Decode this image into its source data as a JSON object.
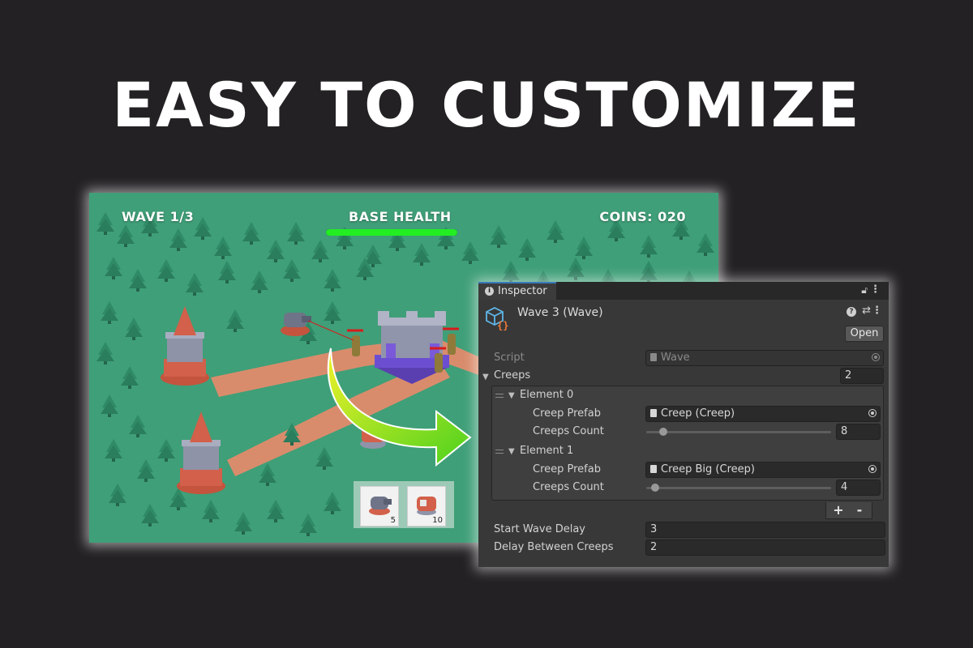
{
  "headline": "EASY TO CUSTOMIZE",
  "game": {
    "wave_label": "WAVE 1/3",
    "base_health_label": "BASE HEALTH",
    "base_health_fraction": 1.0,
    "coins_label": "COINS: 020",
    "shop": [
      {
        "icon": "cannon-tower-icon",
        "price": "5"
      },
      {
        "icon": "flame-tower-icon",
        "price": "10"
      }
    ],
    "colors": {
      "grass": "#3f9f78",
      "path": "#d98c6c",
      "tree": "#2f8a66",
      "health": "#22ee22",
      "arrow": "#a6e21a"
    }
  },
  "inspector": {
    "tab_label": "Inspector",
    "tab_icon": "info-icon",
    "object_title": "Wave 3 (Wave)",
    "object_icon": "script-object-icon",
    "open_button": "Open",
    "script_label": "Script",
    "script_value": "Wave",
    "creeps_label": "Creeps",
    "creeps_size": "2",
    "elements": [
      {
        "title": "Element 0",
        "prefab_label": "Creep Prefab",
        "prefab_value": "Creep (Creep)",
        "count_label": "Creeps Count",
        "count_value": "8"
      },
      {
        "title": "Element 1",
        "prefab_label": "Creep Prefab",
        "prefab_value": "Creep Big (Creep)",
        "count_label": "Creeps Count",
        "count_value": "4"
      }
    ],
    "add_button": "+",
    "remove_button": "-",
    "start_wave_delay_label": "Start Wave Delay",
    "start_wave_delay_value": "3",
    "delay_between_label": "Delay Between Creeps",
    "delay_between_value": "2"
  }
}
